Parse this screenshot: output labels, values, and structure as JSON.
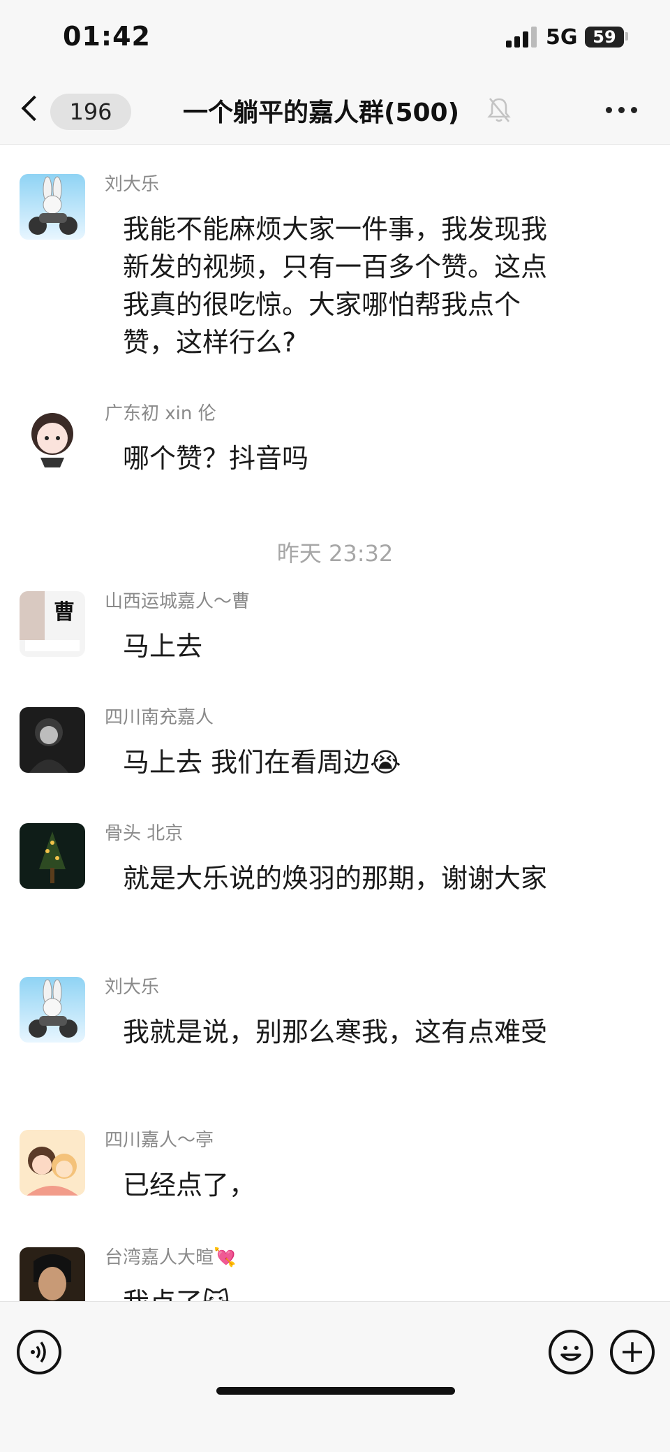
{
  "status_bar": {
    "time": "01:42",
    "network": "5G",
    "battery": "59"
  },
  "header": {
    "back_count": "196",
    "title": "一个躺平的嘉人群(500)"
  },
  "messages": [
    {
      "sender": "刘大乐",
      "text": "我能不能麻烦大家一件事，我发现我新发的视频，只有一百多个赞。这点我真的很吃惊。大家哪怕帮我点个赞，这样行么?"
    },
    {
      "sender": "广东初 xin 伦",
      "text": "哪个赞？抖音吗"
    },
    {
      "sender": "山西运城嘉人～曹",
      "text": "马上去",
      "avatar_text": "曹"
    },
    {
      "sender": "四川南充嘉人",
      "text": "马上去 我们在看周边😭"
    },
    {
      "sender": "骨头  北京",
      "text": "就是大乐说的焕羽的那期，谢谢大家"
    },
    {
      "sender": "刘大乐",
      "text": "我就是说，别那么寒我，这有点难受"
    },
    {
      "sender": "四川嘉人～亭",
      "text": "已经点了，"
    },
    {
      "sender": "台湾嘉人大暄💘",
      "text": "我点了😺"
    }
  ],
  "timestamp_divider": "昨天 23:32",
  "icons": {
    "back": "chevron-left-icon",
    "mute": "bell-slash-icon",
    "more": "more-dots-icon",
    "voice": "voice-icon",
    "emoji": "emoji-icon",
    "add": "plus-icon"
  }
}
